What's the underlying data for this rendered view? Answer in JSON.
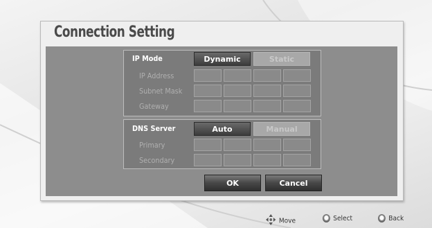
{
  "dialog": {
    "title": "Connection Setting"
  },
  "ip": {
    "mode_label": "IP Mode",
    "dynamic_label": "Dynamic",
    "static_label": "Static",
    "selected": "Dynamic",
    "fields": [
      {
        "label": "IP Address"
      },
      {
        "label": "Subnet Mask"
      },
      {
        "label": "Gateway"
      }
    ]
  },
  "dns": {
    "server_label": "DNS Server",
    "auto_label": "Auto",
    "manual_label": "Manual",
    "selected": "Auto",
    "fields": [
      {
        "label": "Primary"
      },
      {
        "label": "Secondary"
      }
    ]
  },
  "actions": {
    "ok_label": "OK",
    "cancel_label": "Cancel"
  },
  "footer": {
    "move_label": "Move",
    "select_label": "Select",
    "back_label": "Back",
    "move_icon": "dpad-arrows-icon",
    "select_icon": "enter-button-icon",
    "back_icon": "return-button-icon"
  },
  "colors": {
    "active_button": "#3f3f3f",
    "inactive_button": "#a8a8a8",
    "panel": "#8d8d8d"
  }
}
